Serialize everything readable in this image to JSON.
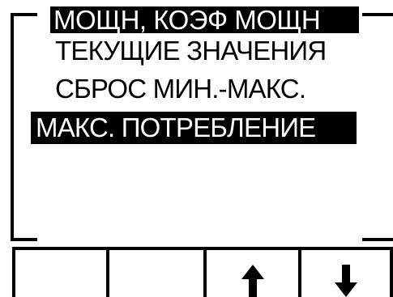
{
  "screen": {
    "title": "МОЩН, КОЭФ МОЩН",
    "menu_items": [
      {
        "label": "ТЕКУЩИЕ ЗНАЧЕНИЯ",
        "selected": false
      },
      {
        "label": "СБРОС МИН.-МАКС.",
        "selected": false
      },
      {
        "label": "МАКС. ПОТРЕБЛЕНИЕ",
        "selected": true
      }
    ]
  },
  "softkeys": [
    {
      "icon": "none"
    },
    {
      "icon": "none"
    },
    {
      "icon": "arrow-up-icon"
    },
    {
      "icon": "arrow-down-icon"
    }
  ]
}
